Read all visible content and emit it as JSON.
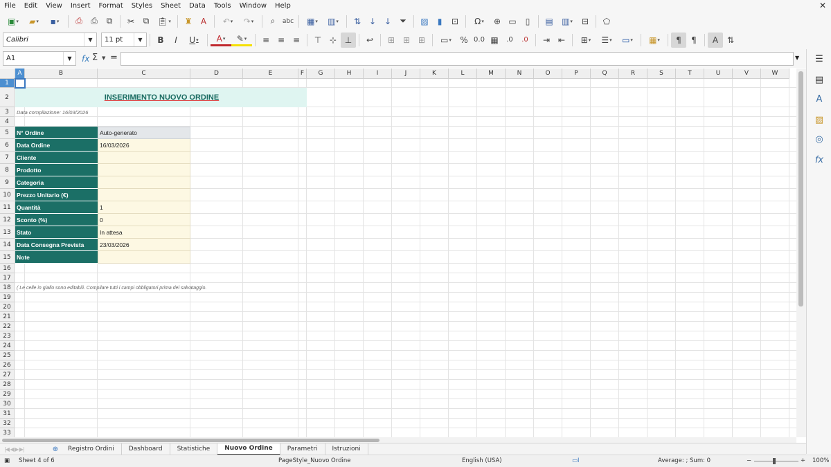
{
  "menu": [
    "File",
    "Edit",
    "View",
    "Insert",
    "Format",
    "Styles",
    "Sheet",
    "Data",
    "Tools",
    "Window",
    "Help"
  ],
  "toolbar": {
    "font_name": "Calibri",
    "font_size": "11 pt"
  },
  "formula_bar": {
    "cell_ref": "A1",
    "content": ""
  },
  "columns": [
    "A",
    "B",
    "C",
    "D",
    "E",
    "F",
    "G",
    "H",
    "I",
    "J",
    "K",
    "L",
    "M",
    "N",
    "O",
    "P",
    "Q",
    "R",
    "S",
    "T",
    "U",
    "V",
    "W"
  ],
  "rows": [
    "1",
    "2",
    "3",
    "4",
    "5",
    "6",
    "7",
    "8",
    "9",
    "10",
    "11",
    "12",
    "13",
    "14",
    "15",
    "16",
    "17",
    "18",
    "19",
    "20",
    "21",
    "22",
    "23",
    "24",
    "25",
    "26",
    "27",
    "28",
    "29",
    "30",
    "31",
    "32",
    "33"
  ],
  "sheet": {
    "title": "INSERIMENTO NUOVO ORDINE",
    "date_line": "Data compilazione: 16/03/2026",
    "fields": [
      {
        "label": "N° Ordine",
        "value": "Auto-generato"
      },
      {
        "label": "Data Ordine",
        "value": "16/03/2026"
      },
      {
        "label": "Cliente",
        "value": ""
      },
      {
        "label": "Prodotto",
        "value": ""
      },
      {
        "label": "Categoria",
        "value": ""
      },
      {
        "label": "Prezzo Unitario (€)",
        "value": ""
      },
      {
        "label": "Quantità",
        "value": "1"
      },
      {
        "label": "Sconto (%)",
        "value": "0"
      },
      {
        "label": "Stato",
        "value": "In attesa"
      },
      {
        "label": "Data Consegna Prevista",
        "value": "23/03/2026"
      },
      {
        "label": "Note",
        "value": ""
      }
    ],
    "footnote": "( Le celle in giallo sono editabili. Compilare tutti i campi obbligatori prima del salvataggio."
  },
  "tabs": [
    "Registro Ordini",
    "Dashboard",
    "Statistiche",
    "Nuovo Ordine",
    "Parametri",
    "Istruzioni"
  ],
  "active_tab": "Nuovo Ordine",
  "status": {
    "sheet": "Sheet 4 of 6",
    "page_style": "PageStyle_Nuovo Ordine",
    "language": "English (USA)",
    "summary": "Average: ; Sum: 0",
    "zoom": "100%"
  }
}
